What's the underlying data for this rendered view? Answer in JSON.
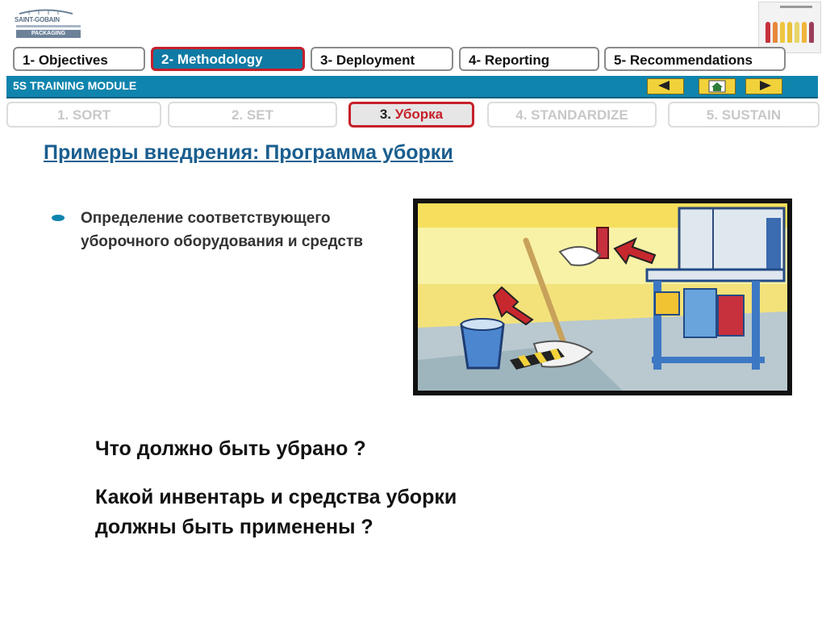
{
  "logo": {
    "brand": "SAINT-GOBAIN",
    "sub": "PACKAGING"
  },
  "tabs": [
    {
      "label": "1- Objectives"
    },
    {
      "label": "2- Methodology"
    },
    {
      "label": "3- Deployment"
    },
    {
      "label": "4- Reporting"
    },
    {
      "label": "5- Recommendations"
    }
  ],
  "module": {
    "title": "5S TRAINING MODULE"
  },
  "steps": [
    {
      "label": "1. SORT"
    },
    {
      "label": "2. SET"
    },
    {
      "label_prefix": "3. ",
      "label_highlight": "Уборка"
    },
    {
      "label": "4. STANDARDIZE"
    },
    {
      "label": "5. SUSTAIN"
    }
  ],
  "content": {
    "heading": "Примеры внедрения: Программа уборки",
    "bullet": "Определение соответствующего уборочного оборудования и средств",
    "question1": "Что должно быть убрано ?",
    "question2": "Какой инвентарь и средства уборки должны быть применены ?"
  },
  "colors": {
    "accent_blue": "#0f84ad",
    "active_border": "#c6202a",
    "heading_blue": "#1a5e8f",
    "nav_yellow": "#f2d23b"
  },
  "icons": [
    "arrow-left-icon",
    "home-icon",
    "arrow-right-icon",
    "bullet-icon"
  ]
}
